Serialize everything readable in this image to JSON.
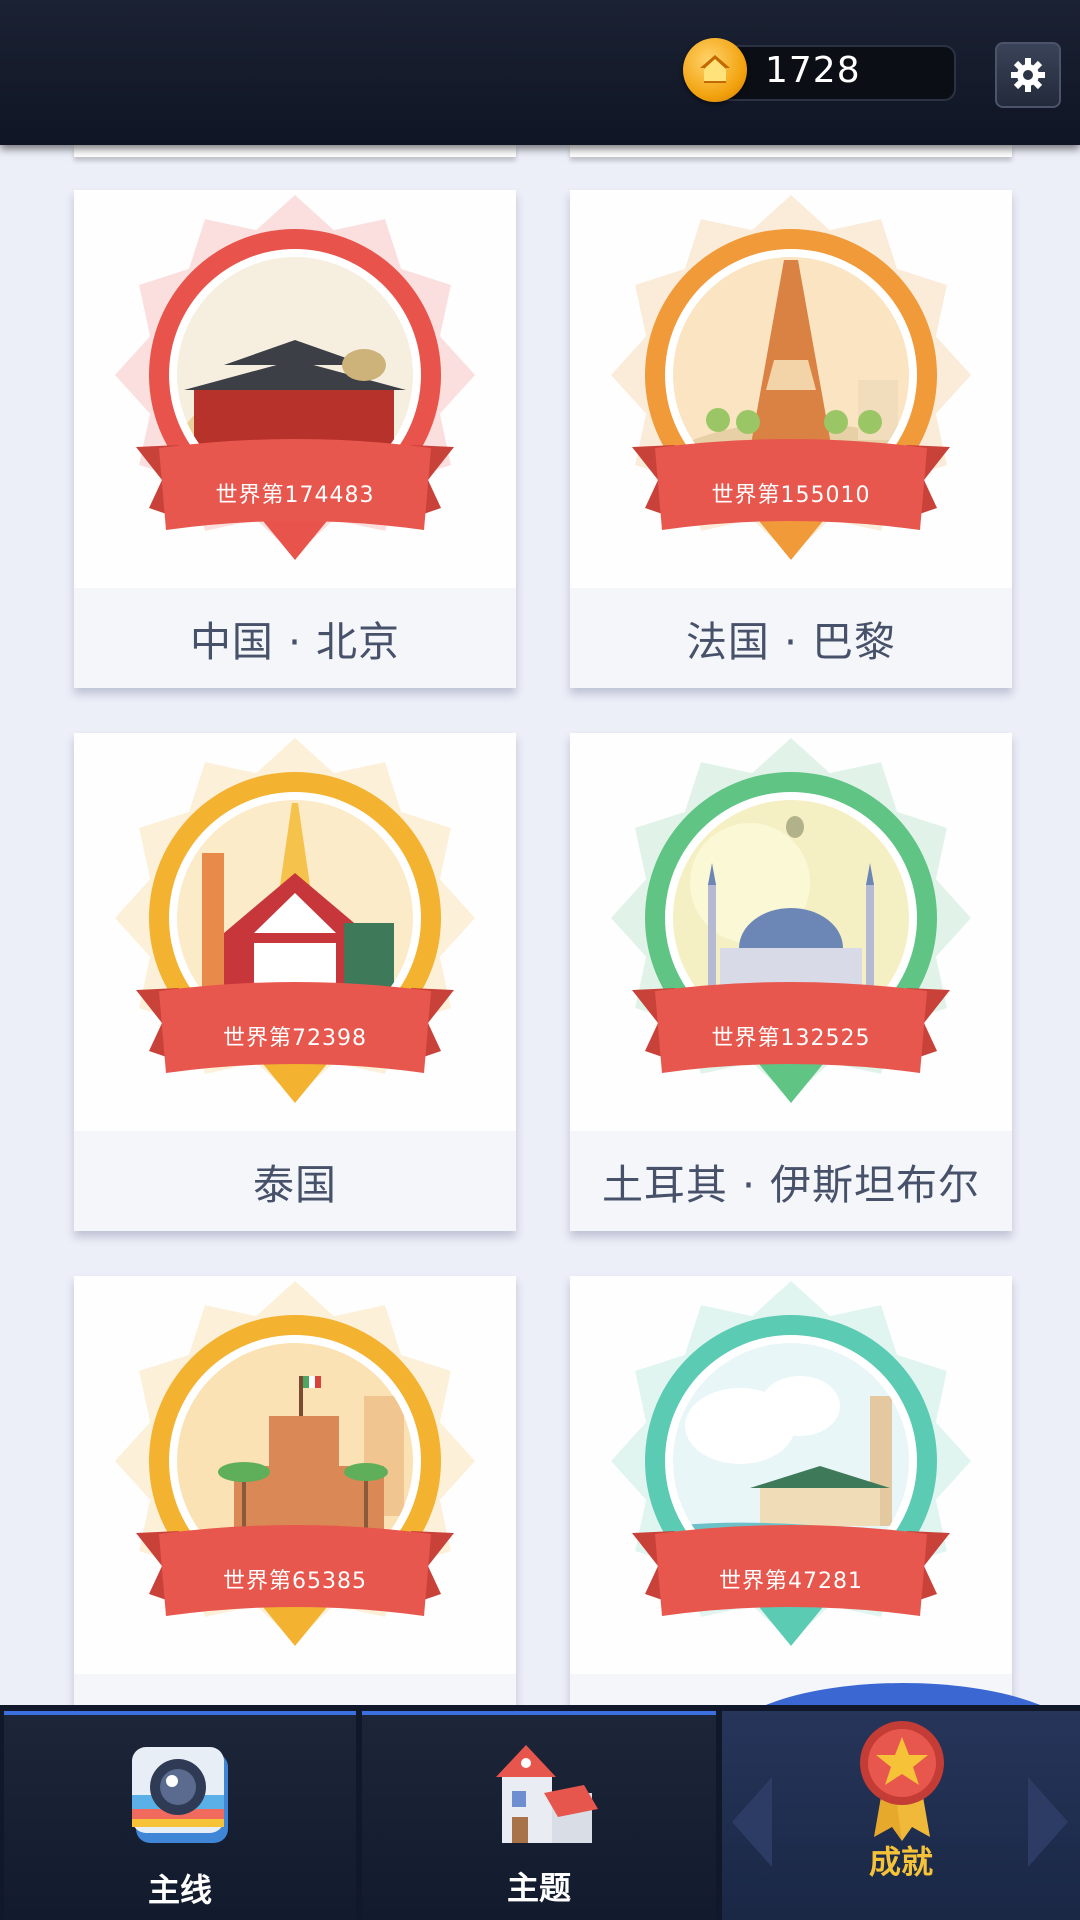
{
  "header": {
    "coins": "1728",
    "coin_icon": "home-coin-icon",
    "settings_icon": "gear-icon"
  },
  "cards": [
    {
      "rank": "世界第174483",
      "caption": "中国 · 北京",
      "color": "#e8544b",
      "scene": "beijing"
    },
    {
      "rank": "世界第155010",
      "caption": "法国 · 巴黎",
      "color": "#f09a3a",
      "scene": "paris"
    },
    {
      "rank": "世界第72398",
      "caption": "泰国",
      "color": "#f3b230",
      "scene": "thailand"
    },
    {
      "rank": "世界第132525",
      "caption": "土耳其 · 伊斯坦布尔",
      "color": "#5fc484",
      "scene": "istanbul"
    },
    {
      "rank": "世界第65385",
      "caption": "",
      "color": "#f3b230",
      "scene": "mexico"
    },
    {
      "rank": "世界第47281",
      "caption": "",
      "color": "#5ccbb3",
      "scene": "morocco"
    }
  ],
  "nav": {
    "tabs": [
      {
        "label": "主线",
        "icon": "camera-icon"
      },
      {
        "label": "主题",
        "icon": "house-icon"
      },
      {
        "label": "成就",
        "icon": "star-medal-icon",
        "active": true
      }
    ]
  }
}
